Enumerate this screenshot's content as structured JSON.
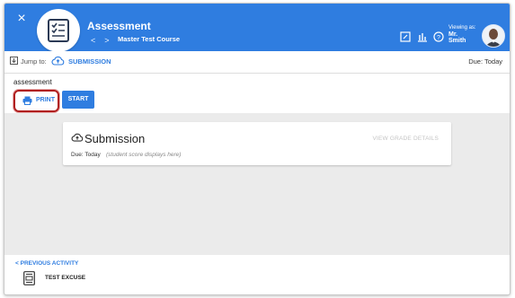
{
  "header": {
    "close_label": "×",
    "title": "Assessment",
    "course": "Master Test Course",
    "viewing_as_label": "Viewing as:",
    "viewer_name_line1": "Mr.",
    "viewer_name_line2": "Smith",
    "icons": [
      "edit-icon",
      "bar-chart-icon",
      "help-icon"
    ],
    "accent_color": "#2f7de0"
  },
  "jumpbar": {
    "jump_label": "Jump to:",
    "section_link": "SUBMISSION",
    "due": "Due: Today"
  },
  "content": {
    "assessment_label": "assessment",
    "print_label": "PRINT",
    "start_label": "START"
  },
  "card": {
    "heading": "Submission",
    "grade_details_label": "VIEW GRADE DETAILS",
    "due": "Due: Today",
    "score_note": "(student score displays here)"
  },
  "footer": {
    "previous_label": "PREVIOUS ACTIVITY",
    "previous_title": "TEST EXCUSE"
  }
}
